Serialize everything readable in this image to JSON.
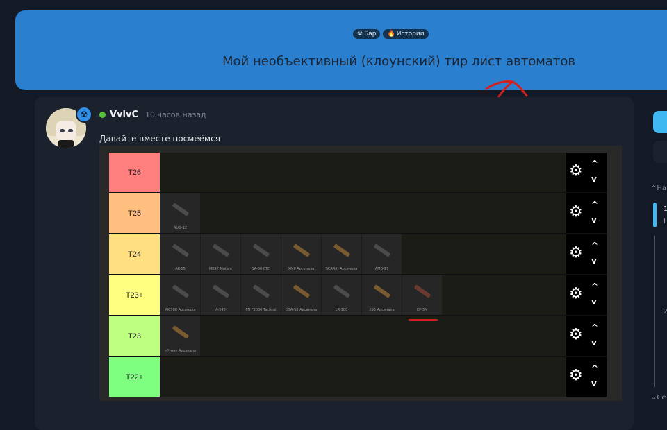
{
  "header": {
    "tags": [
      {
        "icon": "radiation-icon",
        "glyph": "☢",
        "label": "Бар"
      },
      {
        "icon": "fire-icon",
        "glyph": "🔥",
        "label": "Истории"
      }
    ],
    "title": "Мой необъективный (клоунский) тир лист автоматов"
  },
  "post": {
    "author": "VvlvC",
    "time": "10 часов назад",
    "text": "Давайте вместе посмеёмся",
    "badge_glyph": "☢"
  },
  "tiers": [
    {
      "label": "T26",
      "color": "#ff7f7f",
      "items": []
    },
    {
      "label": "T25",
      "color": "#ffbf7f",
      "items": [
        "AUG-12"
      ]
    },
    {
      "label": "T24",
      "color": "#ffdf7f",
      "items": [
        "AK-15",
        "MK47 Mutant",
        "SA-58 CTC",
        "XM8 Арсенала",
        "SCAR-H Арсенала",
        "AMB-17"
      ]
    },
    {
      "label": "T23+",
      "color": "#ffff7f",
      "items": [
        "AK-308 Арсенала",
        "A-545",
        "FN F2000 Tactical",
        "DSA-58 Арсенала",
        "LR-300",
        "X95 Арсенала",
        "СР-3М"
      ]
    },
    {
      "label": "T23",
      "color": "#bfff7f",
      "items": [
        "«Руна» Арсенала"
      ]
    },
    {
      "label": "T22+",
      "color": "#7fff7f",
      "items": []
    }
  ],
  "controls": {
    "gear_glyph": "⚙",
    "up_glyph": "^",
    "down_glyph": "v"
  },
  "sidebar": {
    "label_top": "На",
    "label_bottom": "Се",
    "timeline_1": "1",
    "timeline_2": "I",
    "timeline_3": "2"
  }
}
